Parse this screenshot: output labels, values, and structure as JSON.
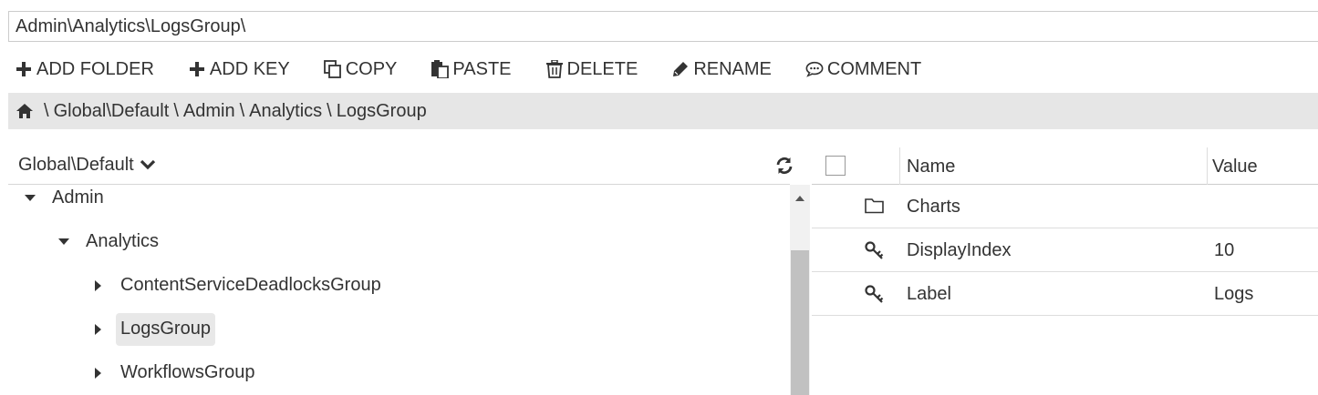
{
  "path_field": {
    "value": "Admin\\Analytics\\LogsGroup\\"
  },
  "toolbar": {
    "add_folder": "ADD FOLDER",
    "add_key": "ADD KEY",
    "copy": "COPY",
    "paste": "PASTE",
    "delete": "DELETE",
    "rename": "RENAME",
    "comment": "COMMENT"
  },
  "breadcrumb": {
    "home_icon": "home-icon",
    "items": [
      "Global\\Default",
      "Admin",
      "Analytics",
      "LogsGroup"
    ]
  },
  "tree": {
    "root_selector": "Global\\Default",
    "nodes": [
      {
        "label": "Admin",
        "expanded": true
      },
      {
        "label": "Analytics",
        "expanded": true
      },
      {
        "label": "ContentServiceDeadlocksGroup",
        "expanded": false
      },
      {
        "label": "LogsGroup",
        "expanded": false,
        "selected": true
      },
      {
        "label": "WorkflowsGroup",
        "expanded": false
      }
    ]
  },
  "grid": {
    "columns": {
      "name": "Name",
      "value": "Value"
    },
    "rows": [
      {
        "icon": "folder-icon",
        "name": "Charts",
        "value": ""
      },
      {
        "icon": "key-icon",
        "name": "DisplayIndex",
        "value": "10"
      },
      {
        "icon": "key-icon",
        "name": "Label",
        "value": "Logs"
      }
    ]
  },
  "colors": {
    "crumb_bar_bg": "#e6e6e6",
    "selected_bg": "#e8e8e8",
    "scroll_thumb": "#c1c1c1",
    "text": "#333333"
  }
}
